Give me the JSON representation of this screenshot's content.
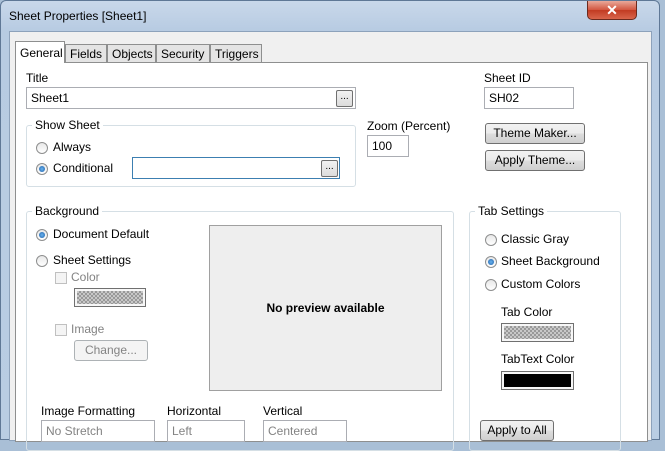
{
  "window": {
    "title": "Sheet Properties [Sheet1]",
    "close_glyph": "✕"
  },
  "tabs": [
    {
      "label": "General",
      "active": true
    },
    {
      "label": "Fields"
    },
    {
      "label": "Objects"
    },
    {
      "label": "Security"
    },
    {
      "label": "Triggers"
    }
  ],
  "general": {
    "title_label": "Title",
    "title_value": "Sheet1",
    "sheet_id_label": "Sheet ID",
    "sheet_id_value": "SH02",
    "dots": "...",
    "show_sheet": {
      "label": "Show Sheet",
      "always_label": "Always",
      "conditional_label": "Conditional",
      "selected": "Conditional",
      "condition_value": ""
    },
    "zoom_label": "Zoom (Percent)",
    "zoom_value": "100",
    "theme_maker_label": "Theme Maker...",
    "apply_theme_label": "Apply Theme...",
    "background": {
      "label": "Background",
      "document_default_label": "Document Default",
      "sheet_settings_label": "Sheet Settings",
      "selected": "Document Default",
      "color_label": "Color",
      "image_label": "Image",
      "change_label": "Change...",
      "preview_text": "No preview available"
    },
    "image_formatting": {
      "label": "Image Formatting",
      "value": "No Stretch",
      "horizontal_label": "Horizontal",
      "horizontal_value": "Left",
      "vertical_label": "Vertical",
      "vertical_value": "Centered"
    },
    "tab_settings": {
      "label": "Tab Settings",
      "classic_gray_label": "Classic Gray",
      "sheet_background_label": "Sheet Background",
      "custom_colors_label": "Custom Colors",
      "selected": "Sheet Background",
      "tab_color_label": "Tab Color",
      "tab_text_color_label": "TabText Color",
      "tab_text_color": "#000000",
      "apply_to_all_label": "Apply to All"
    }
  }
}
